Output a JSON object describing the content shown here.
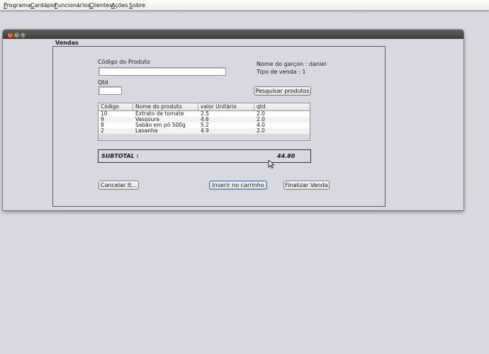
{
  "menubar": {
    "items": [
      "Programa",
      "Cardápio",
      "Funcionários",
      "Clientes",
      "Ações",
      "Sobre"
    ]
  },
  "window": {
    "close_glyph": "×",
    "min_glyph": "–",
    "max_glyph": "□"
  },
  "vendas": {
    "title": "Vendas",
    "codigo_label": "Código do Produto",
    "codigo_value": "",
    "qtd_label": "Qtd",
    "qtd_value": "",
    "garcom_text": "Nome do garçon : daniel",
    "tipo_venda_text": "Tipo de venda : 1",
    "pesquisar_button": "Pesquisar produtos",
    "table": {
      "headers": [
        "Código",
        "Nome do produto",
        "valor Unitário",
        "qtd"
      ],
      "rows": [
        [
          "10",
          "Extrato de tomate",
          "2.5",
          "2.0"
        ],
        [
          "9",
          "Vassoura",
          "4.6",
          "2.0"
        ],
        [
          "8",
          "Sabão em pó 500g",
          "5.2",
          "4.0"
        ],
        [
          "2",
          "Lasanha",
          "4.9",
          "2.0"
        ]
      ]
    },
    "subtotal_label": "SUBTOTAL :",
    "subtotal_value": "44.80",
    "cancelar_button": "Cancelar It...",
    "inserir_button": "Inserir no carrinho",
    "finalizar_button": "Finalizar Venda"
  },
  "colors": {
    "background": "#d6d9df",
    "titlebar": "#4a4945",
    "close_button": "#dd4814"
  }
}
